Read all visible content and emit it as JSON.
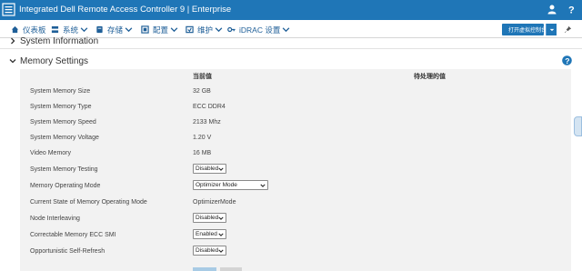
{
  "titlebar": {
    "title": "Integrated Dell Remote Access Controller 9 | Enterprise",
    "bg_color": "#1f76b7"
  },
  "nav": {
    "items": [
      {
        "label": "仪表板",
        "icon": "home-icon",
        "has_menu": false
      },
      {
        "label": "系统",
        "icon": "server-icon",
        "has_menu": true
      },
      {
        "label": "存储",
        "icon": "storage-icon",
        "has_menu": true
      },
      {
        "label": "配置",
        "icon": "config-icon",
        "has_menu": true
      },
      {
        "label": "维护",
        "icon": "maintenance-icon",
        "has_menu": true
      },
      {
        "label": "iDRAC 设置",
        "icon": "idrac-settings-icon",
        "has_menu": true
      }
    ],
    "open_virtual_console": "打开虚拟控制台"
  },
  "sections": {
    "system_information": "System Information",
    "memory_settings": "Memory Settings"
  },
  "table": {
    "col_current": "当前值",
    "col_pending": "待处理的值",
    "rows": [
      {
        "label": "System Memory Size",
        "value": "32 GB",
        "type": "text"
      },
      {
        "label": "System Memory Type",
        "value": "ECC DDR4",
        "type": "text"
      },
      {
        "label": "System Memory Speed",
        "value": "2133 Mhz",
        "type": "text"
      },
      {
        "label": "System Memory Voltage",
        "value": "1.20 V",
        "type": "text"
      },
      {
        "label": "Video Memory",
        "value": "16 MB",
        "type": "text"
      },
      {
        "label": "System Memory Testing",
        "value": "Disabled",
        "type": "select"
      },
      {
        "label": "Memory Operating Mode",
        "value": "Optimizer Mode",
        "type": "select"
      },
      {
        "label": "Current State of Memory Operating Mode",
        "value": "OptimizerMode",
        "type": "text"
      },
      {
        "label": "Node Interleaving",
        "value": "Disabled",
        "type": "select"
      },
      {
        "label": "Correctable Memory ECC SMI",
        "value": "Enabled",
        "type": "select"
      },
      {
        "label": "Opportunistic Self-Refresh",
        "value": "Disabled",
        "type": "select"
      }
    ]
  },
  "colors": {
    "accent": "#1f76b7",
    "panel_bg": "#f2f2f2"
  }
}
